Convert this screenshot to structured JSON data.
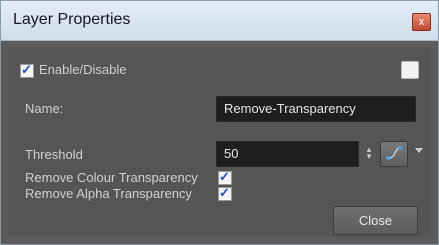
{
  "window": {
    "title": "Layer Properties"
  },
  "enable": {
    "label": "Enable/Disable",
    "checked": true
  },
  "name": {
    "label": "Name:",
    "value": "Remove-Transparency"
  },
  "threshold": {
    "label": "Threshold",
    "value": "50"
  },
  "remove_colour": {
    "label": "Remove Colour Transparency",
    "checked": true
  },
  "remove_alpha": {
    "label": "Remove Alpha Transparency",
    "checked": true
  },
  "buttons": {
    "close": "Close"
  },
  "glyphs": {
    "close_x": "x",
    "check": "✓",
    "spin_up": "▴",
    "spin_down": "▾"
  },
  "icons": [
    "close-icon",
    "color-swatch-icon",
    "curve-icon",
    "chevron-down-icon"
  ],
  "colors": {
    "title_bar": "#d9e5f1",
    "panel": "#555555",
    "field_bg": "#1e1e1e",
    "check_blue": "#2050b8"
  }
}
